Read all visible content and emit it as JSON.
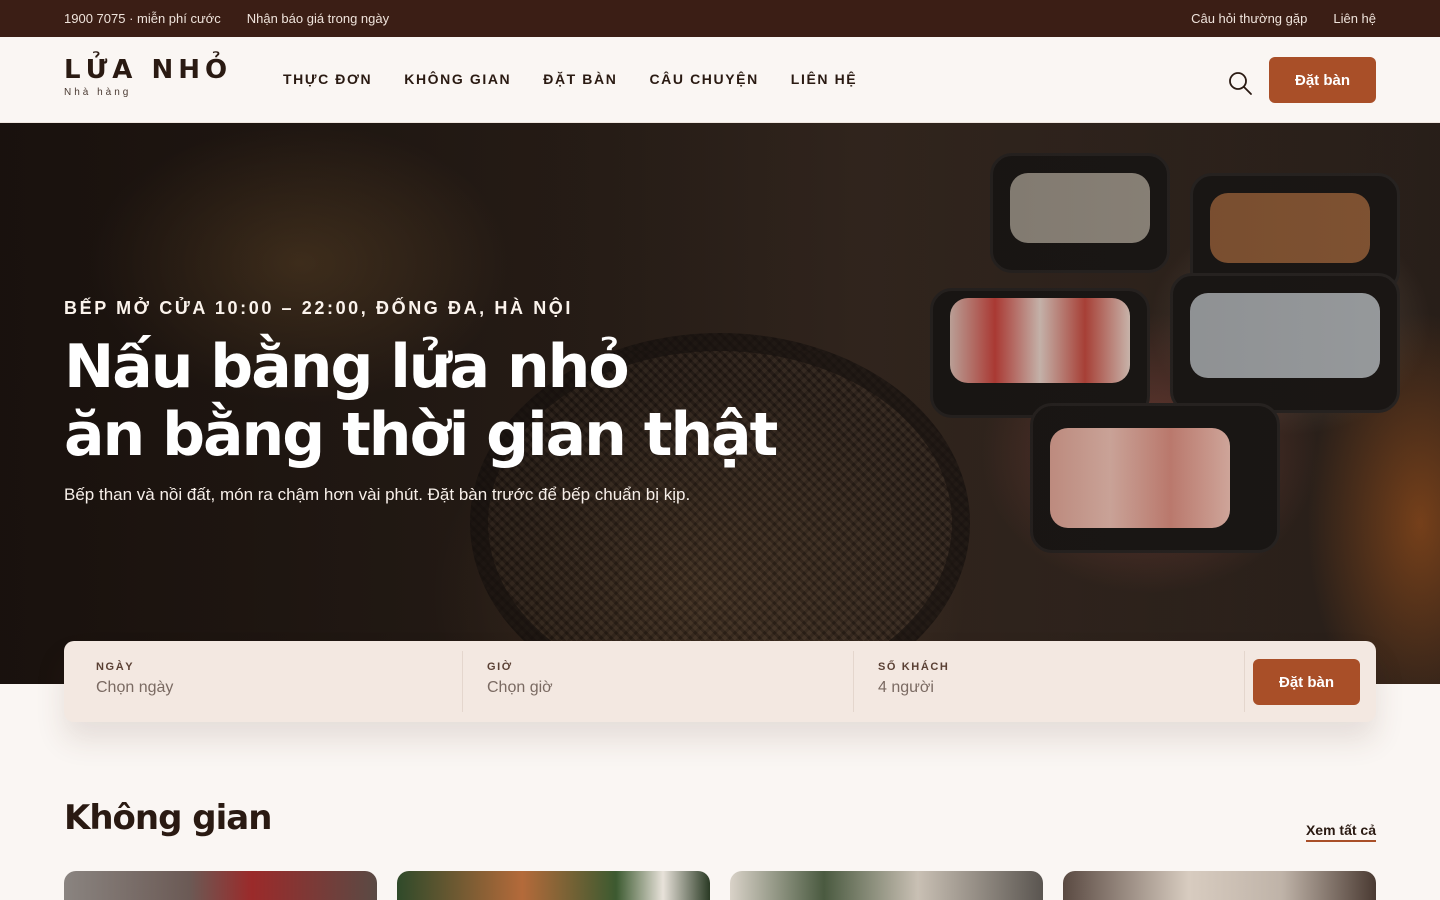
{
  "topbar": {
    "phone": "1900 7075 · miễn phí cước",
    "quote": "Nhận báo giá trong ngày",
    "faq": "Câu hỏi thường gặp",
    "contact": "Liên hệ"
  },
  "header": {
    "logo_name": "LỬA NHỎ",
    "logo_sub": "Nhà hàng",
    "nav": [
      "THỰC ĐƠN",
      "KHÔNG GIAN",
      "ĐẶT BÀN",
      "CÂU CHUYỆN",
      "LIÊN HỆ"
    ],
    "search_icon": "search-icon",
    "cta_label": "Đặt bàn"
  },
  "hero": {
    "eyebrow": "BẾP MỞ CỬA 10:00 – 22:00, ĐỐNG ĐA, HÀ NỘI",
    "headline_line1": "Nấu bằng lửa nhỏ",
    "headline_line2": "ăn bằng thời gian thật",
    "subtitle": "Bếp than và nồi đất, món ra chậm hơn vài phút. Đặt bàn trước để bếp chuẩn bị kịp."
  },
  "booking": {
    "date_label": "NGÀY",
    "date_placeholder": "Chọn ngày",
    "time_label": "GIỜ",
    "time_placeholder": "Chọn giờ",
    "guests_label": "SỐ KHÁCH",
    "guests_value": "4 người",
    "submit_label": "Đặt bàn"
  },
  "section": {
    "title": "Không gian",
    "see_all": "Xem tất cả"
  },
  "colors": {
    "topbar_bg": "#3b1e15",
    "accent": "#a94f28",
    "page_bg": "#faf6f3",
    "booking_bg": "#f3e8e1"
  }
}
